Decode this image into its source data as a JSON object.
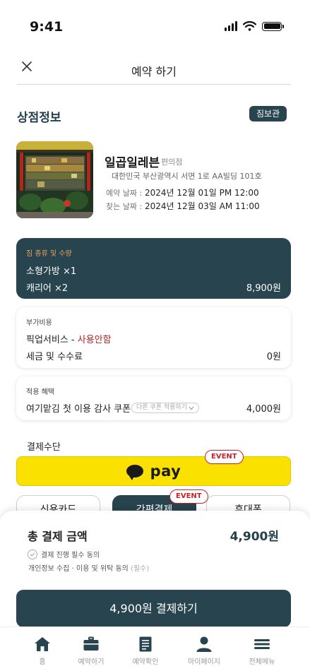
{
  "status": {
    "time": "9:41"
  },
  "header": {
    "title": "예약 하기",
    "close_icon": "close-icon"
  },
  "store": {
    "section_title": "상점정보",
    "badge": "짐보관",
    "name": "일곱일레븐",
    "category": "편의점",
    "address": "대한민국 부산광역시 서면 1로 AA빌딩 101호",
    "reserve_label": "예약 날짜 :",
    "reserve_value": "2024년 12월 01일 PM 12:00",
    "pickup_label": "찾는 날짜 :",
    "pickup_value": "2024년 12월 03일 AM 11:00"
  },
  "luggage": {
    "caption": "짐 종류 및 수량",
    "items": [
      "소형가방 ×1",
      "캐리어 ×2"
    ],
    "amount": "8,900원"
  },
  "extra": {
    "caption": "부가비용",
    "pickup_service": "픽업서비스 - ",
    "pickup_status": "사용안함",
    "tax_label": "세금 및 수수료",
    "tax_amount": "0원"
  },
  "benefit": {
    "caption": "적용 혜택",
    "coupon": "여기맡김 첫 이용 감사 쿠폰",
    "other_coupon_button": "다른 쿠폰 적용하기",
    "amount": "4,000원"
  },
  "payment": {
    "label": "결제수단",
    "kakao_text": "pay",
    "event_tag": "EVENT",
    "options": [
      "신용카드",
      "간편결제",
      "휴대폰"
    ]
  },
  "summary": {
    "total_label": "총 결제 금액",
    "total_amount": "4,900원",
    "agree_all": "결제 진행 필수 동의",
    "agree_sub": "개인정보 수집 · 이용 및 위탁 동의",
    "agree_required": "(필수)",
    "pay_button": "4,900원 결제하기"
  },
  "tabbar": {
    "items": [
      "홈",
      "예약하기",
      "예약확인",
      "마이페이지",
      "전체메뉴"
    ],
    "icons": [
      "home-icon",
      "briefcase-icon",
      "document-icon",
      "person-icon",
      "menu-icon"
    ]
  },
  "colors": {
    "primary": "#27444f",
    "kakao": "#fae100",
    "event": "#c4252d",
    "caption_orange": "#e8a35a"
  }
}
